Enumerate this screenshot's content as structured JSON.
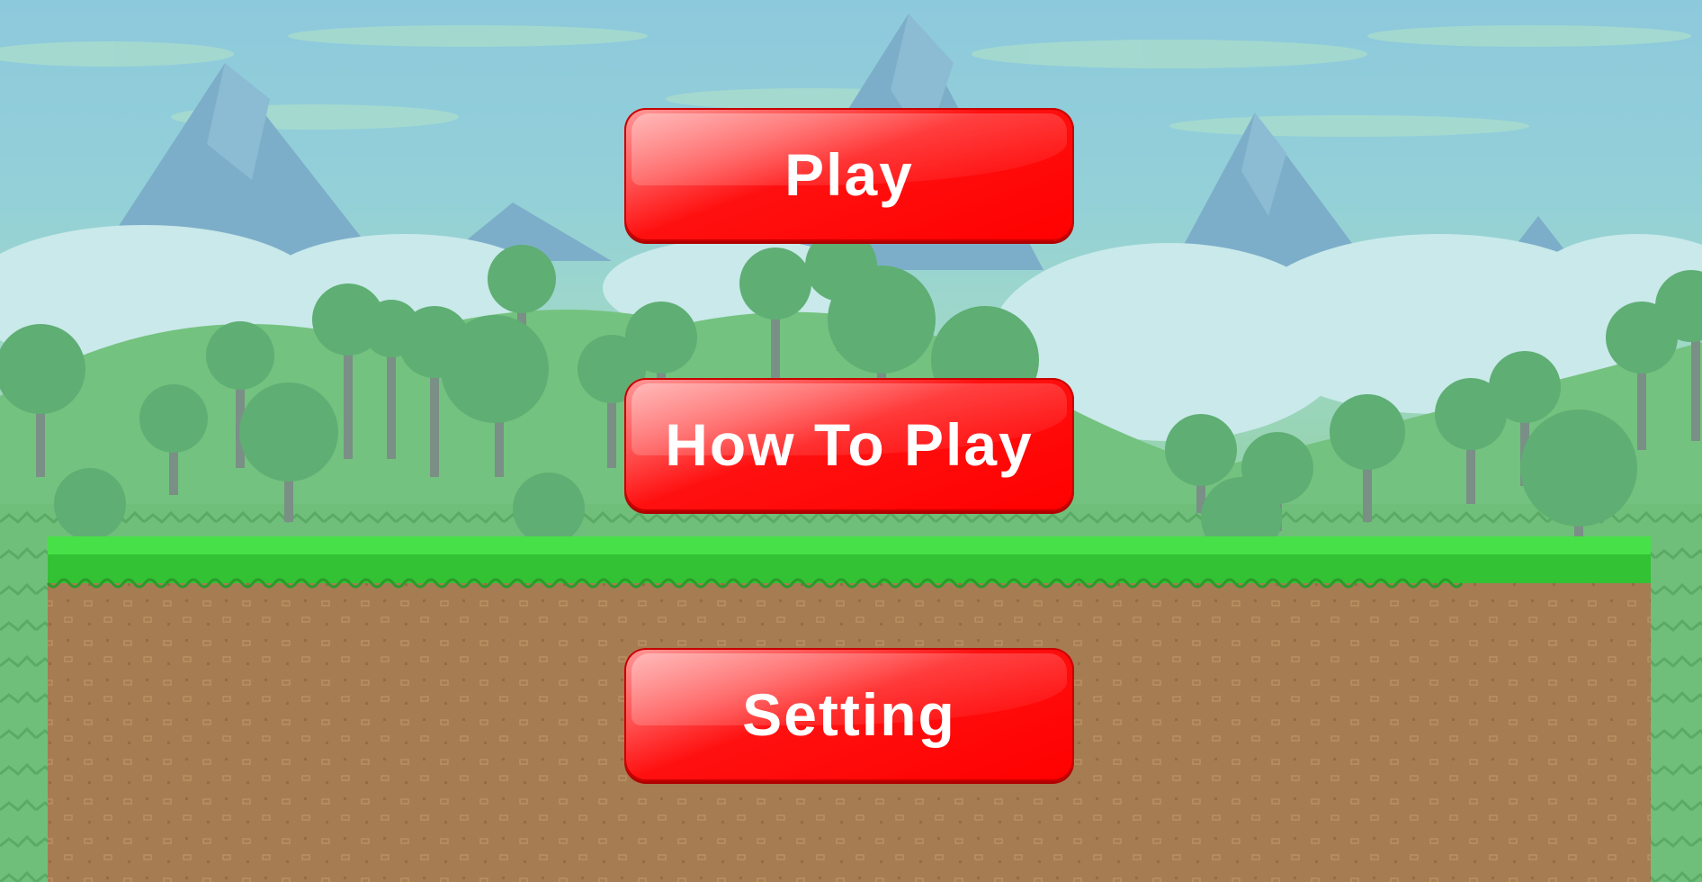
{
  "menu": {
    "play_label": "Play",
    "how_to_play_label": "How To Play",
    "setting_label": "Setting"
  },
  "colors": {
    "button_red": "#ff0000",
    "grass": "#33c233",
    "dirt": "#a67c52",
    "sky": "#8dc9dc"
  }
}
